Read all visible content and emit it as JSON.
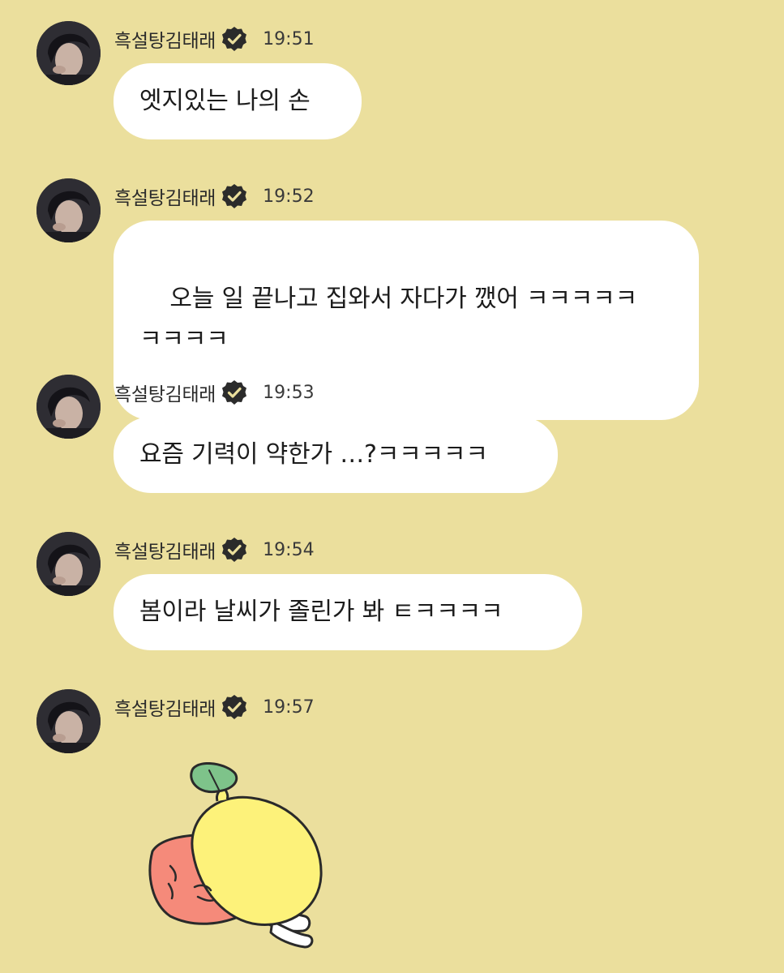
{
  "sender": {
    "name": "흑설탕김태래",
    "verified_icon": "verified-badge-icon",
    "avatar": "profile-avatar"
  },
  "messages": [
    {
      "time": "19:51",
      "text": "엣지있는 나의 손"
    },
    {
      "time": "19:52",
      "text": "오늘 일 끝나고 집와서 자다가 깼어 ㅋㅋㅋㅋㅋ\nㅋㅋㅋㅋ"
    },
    {
      "time": "19:53",
      "text": "요즘 기력이 약한가 …?ㅋㅋㅋㅋㅋ"
    },
    {
      "time": "19:54",
      "text": "봄이라 날씨가 졸린가 봐 ㅌㅋㅋㅋㅋ"
    },
    {
      "time": "19:57",
      "sticker": "sleeping-lemon-sticker"
    }
  ],
  "colors": {
    "background": "#ebdf9d",
    "bubble": "#ffffff",
    "text": "#1c1c1c",
    "lemon": "#fdf27a",
    "pillow": "#f58a7a",
    "leaf": "#7ec38a"
  }
}
